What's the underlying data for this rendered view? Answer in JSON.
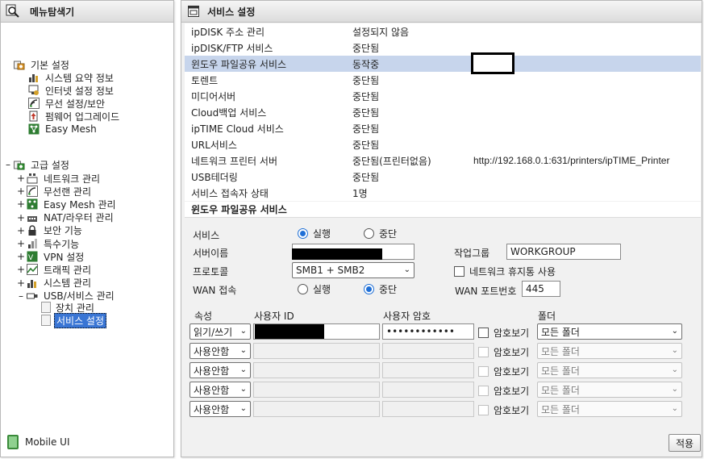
{
  "left_panel": {
    "title": "메뉴탐색기",
    "basic": {
      "label": "기본 설정",
      "items": [
        "시스템 요약 정보",
        "인터넷 설정 정보",
        "무선 설정/보안",
        "펌웨어 업그레이드",
        "Easy Mesh"
      ]
    },
    "advanced": {
      "label": "고급 설정",
      "expand_symbol": "–",
      "items": [
        {
          "label": "네트워크 관리",
          "exp": "+"
        },
        {
          "label": "무선랜 관리",
          "exp": "+"
        },
        {
          "label": "Easy Mesh 관리",
          "exp": "+"
        },
        {
          "label": "NAT/라우터 관리",
          "exp": "+"
        },
        {
          "label": "보안 기능",
          "exp": "+"
        },
        {
          "label": "특수기능",
          "exp": "+"
        },
        {
          "label": "VPN 설정",
          "exp": "+"
        },
        {
          "label": "트래픽 관리",
          "exp": "+"
        },
        {
          "label": "시스템 관리",
          "exp": "+"
        },
        {
          "label": "USB/서비스 관리",
          "exp": "–"
        }
      ],
      "usb_children": [
        "장치 관리",
        "서비스 설정"
      ]
    },
    "mobile_label": "Mobile UI"
  },
  "right_panel": {
    "title": "서비스 설정",
    "status_rows": [
      {
        "name": "ipDISK 주소 관리",
        "status": "설정되지 않음",
        "extra": ""
      },
      {
        "name": "ipDISK/FTP 서비스",
        "status": "중단됨",
        "extra": ""
      },
      {
        "name": "윈도우 파일공유 서비스",
        "status": "동작중",
        "extra": ""
      },
      {
        "name": "토렌트",
        "status": "중단됨",
        "extra": ""
      },
      {
        "name": "미디어서버",
        "status": "중단됨",
        "extra": ""
      },
      {
        "name": "Cloud백업 서비스",
        "status": "중단됨",
        "extra": ""
      },
      {
        "name": "ipTIME Cloud 서비스",
        "status": "중단됨",
        "extra": ""
      },
      {
        "name": "URL서비스",
        "status": "중단됨",
        "extra": ""
      },
      {
        "name": "네트워크 프린터 서버",
        "status": "중단됨(프린터없음)",
        "extra": "http://192.168.0.1:631/printers/ipTIME_Printer"
      },
      {
        "name": "USB테더링",
        "status": "중단됨",
        "extra": ""
      },
      {
        "name": "서비스 접속자 상태",
        "status": "1명",
        "extra": ""
      }
    ],
    "section_title": "윈도우 파일공유 서비스",
    "form": {
      "service_label": "서비스",
      "run_label": "실행",
      "stop_label": "중단",
      "server_name_label": "서버이름",
      "workgroup_label": "작업그룹",
      "workgroup_value": "WORKGROUP",
      "protocol_label": "프로토콜",
      "protocol_value": "SMB1 + SMB2",
      "recycle_label": "네트워크 휴지통 사용",
      "wan_label": "WAN 접속",
      "wan_port_label": "WAN 포트번호",
      "wan_port_value": "445"
    },
    "users": {
      "headers": {
        "attr": "속성",
        "user_id": "사용자 ID",
        "password": "사용자 암호",
        "folder": "폴더"
      },
      "show_pw_label": "암호보기",
      "rows": [
        {
          "attr": "읽기/쓰기",
          "password": "••••••••••••",
          "folder": "모든 폴더",
          "enabled": true
        },
        {
          "attr": "사용안함",
          "password": "",
          "folder": "모든 폴더",
          "enabled": false
        },
        {
          "attr": "사용안함",
          "password": "",
          "folder": "모든 폴더",
          "enabled": false
        },
        {
          "attr": "사용안함",
          "password": "",
          "folder": "모든 폴더",
          "enabled": false
        },
        {
          "attr": "사용안함",
          "password": "",
          "folder": "모든 폴더",
          "enabled": false
        }
      ]
    },
    "apply_label": "적용"
  }
}
